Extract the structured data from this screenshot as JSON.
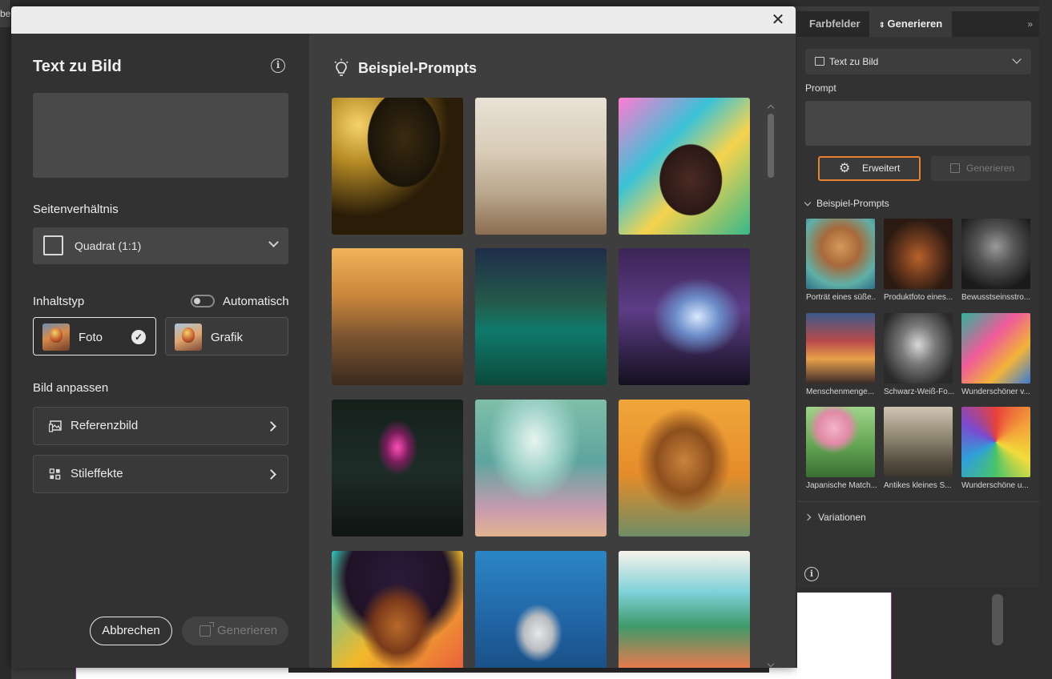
{
  "top_left_tab": "be",
  "modal": {
    "close_glyph": "✕",
    "left": {
      "title": "Text zu Bild",
      "aspect_label": "Seitenverhältnis",
      "aspect_value": "Quadrat (1:1)",
      "content_type_label": "Inhaltstyp",
      "auto_label": "Automatisch",
      "auto_enabled": false,
      "type_options": [
        {
          "label": "Foto",
          "selected": true
        },
        {
          "label": "Grafik",
          "selected": false
        }
      ],
      "adjust_label": "Bild anpassen",
      "adjust_items": [
        "Referenzbild",
        "Stileffekte"
      ],
      "cancel_label": "Abbrechen",
      "generate_label": "Generieren"
    },
    "right": {
      "title": "Beispiel-Prompts",
      "thumbnails": [
        "cosmetics-mirror",
        "kitchen-interior",
        "colorful-portrait",
        "cheetah-elephants",
        "underwater-castle",
        "purple-waterfall",
        "neon-rose",
        "jellyfish",
        "giraffe-sunglasses",
        "afro-portrait",
        "can-splash",
        "palm-street"
      ]
    }
  },
  "panel": {
    "tabs": [
      "Farbfelder",
      "Generieren"
    ],
    "active_tab": "Generieren",
    "mode_value": "Text zu Bild",
    "prompt_label": "Prompt",
    "advanced_label": "Erweitert",
    "generate_label": "Generieren",
    "examples_label": "Beispiel-Prompts",
    "example_captions": [
      "Porträt eines süße...",
      "Produktfoto eines...",
      "Bewusstseinsstro...",
      "Menschenmenge...",
      "Schwarz-Weiß-Fo...",
      "Wunderschöner v...",
      "Japanische Match...",
      "Antikes kleines S...",
      "Wunderschöne u..."
    ],
    "variations_label": "Variationen"
  },
  "colors": {
    "accent_orange": "#e8822f",
    "modal_bg": "#323232",
    "panel_bg": "#323232"
  }
}
